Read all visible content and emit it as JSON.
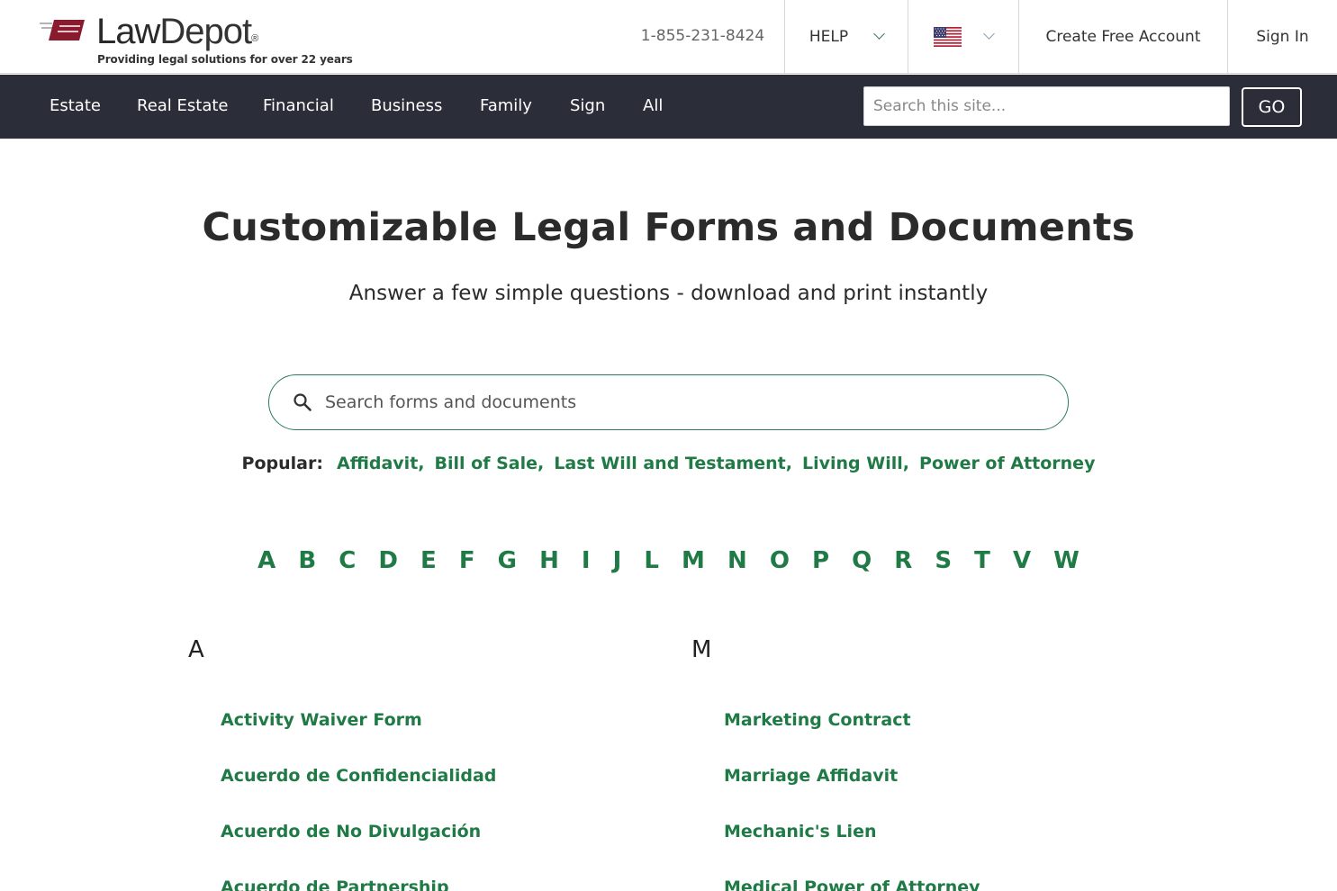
{
  "header": {
    "logo_text_law": "Law",
    "logo_text_depot": "Depot",
    "logo_reg": "®",
    "tagline": "Providing legal solutions for over 22 years",
    "phone": "1-855-231-8424",
    "help_label": "HELP",
    "country_icon": "us-flag-icon",
    "create_account_label": "Create Free Account",
    "sign_in_label": "Sign In",
    "brand_color": "#8a1a2e"
  },
  "nav": {
    "items": [
      "Estate",
      "Real Estate",
      "Financial",
      "Business",
      "Family",
      "Sign",
      "All"
    ],
    "search_placeholder": "Search this site...",
    "go_label": "GO",
    "background": "#2b2e39"
  },
  "hero": {
    "title": "Customizable Legal Forms and Documents",
    "subtitle": "Answer a few simple questions - download and print instantly",
    "search_placeholder": "Search forms and documents",
    "accent_color": "#1f7a46"
  },
  "popular": {
    "label": "Popular:",
    "links": [
      "Affidavit,",
      "Bill of Sale,",
      "Last Will and Testament,",
      "Living Will,",
      "Power of Attorney"
    ]
  },
  "alphabet": [
    "A",
    "B",
    "C",
    "D",
    "E",
    "F",
    "G",
    "H",
    "I",
    "J",
    "L",
    "M",
    "N",
    "O",
    "P",
    "Q",
    "R",
    "S",
    "T",
    "V",
    "W"
  ],
  "columns": [
    {
      "letter": "A",
      "items": [
        "Activity Waiver Form",
        "Acuerdo de Confidencialidad",
        "Acuerdo de No Divulgación",
        "Acuerdo de Partnership"
      ]
    },
    {
      "letter": "M",
      "items": [
        "Marketing Contract",
        "Marriage Affidavit",
        "Mechanic's Lien",
        "Medical Power of Attorney"
      ]
    }
  ]
}
